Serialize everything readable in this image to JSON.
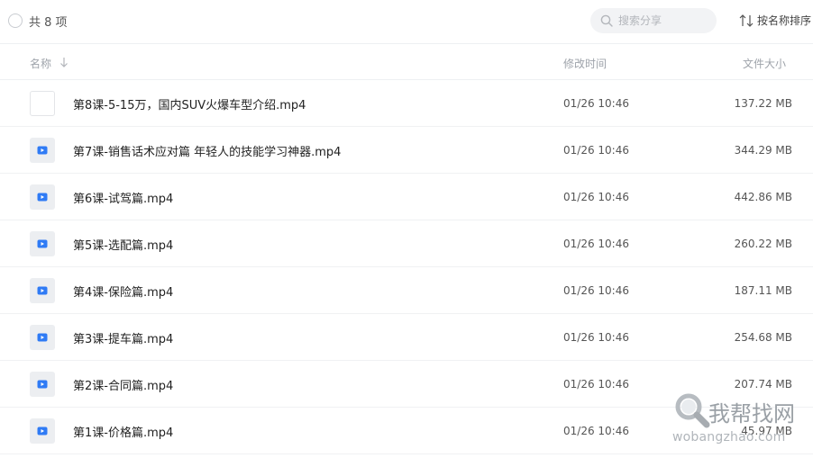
{
  "toolbar": {
    "count_label": "共 8 项",
    "search_placeholder": "搜索分享",
    "sort_label": "按名称排序"
  },
  "columns": {
    "name": "名称",
    "modified": "修改时间",
    "size": "文件大小"
  },
  "files": [
    {
      "name": "第8课-5-15万，国内SUV火爆车型介绍.mp4",
      "modified": "01/26 10:46",
      "size": "137.22 MB",
      "thumb": "blank"
    },
    {
      "name": "第7课-销售话术应对篇 年轻人的技能学习神器.mp4",
      "modified": "01/26 10:46",
      "size": "344.29 MB",
      "thumb": "video-file-icon"
    },
    {
      "name": "第6课-试驾篇.mp4",
      "modified": "01/26 10:46",
      "size": "442.86 MB",
      "thumb": "video-file-icon"
    },
    {
      "name": "第5课-选配篇.mp4",
      "modified": "01/26 10:46",
      "size": "260.22 MB",
      "thumb": "video-file-icon"
    },
    {
      "name": "第4课-保险篇.mp4",
      "modified": "01/26 10:46",
      "size": "187.11 MB",
      "thumb": "video-file-icon"
    },
    {
      "name": "第3课-提车篇.mp4",
      "modified": "01/26 10:46",
      "size": "254.68 MB",
      "thumb": "video-file-icon"
    },
    {
      "name": "第2课-合同篇.mp4",
      "modified": "01/26 10:46",
      "size": "207.74 MB",
      "thumb": "video-file-icon"
    },
    {
      "name": "第1课-价格篇.mp4",
      "modified": "01/26 10:46",
      "size": "45.97 MB",
      "thumb": "video-file-icon"
    }
  ],
  "watermark": {
    "title": "我帮找网",
    "url": "wobangzhao.com"
  },
  "colors": {
    "accent_blue": "#2f7bf5",
    "text": "#222222",
    "muted": "#9ea3aa"
  }
}
